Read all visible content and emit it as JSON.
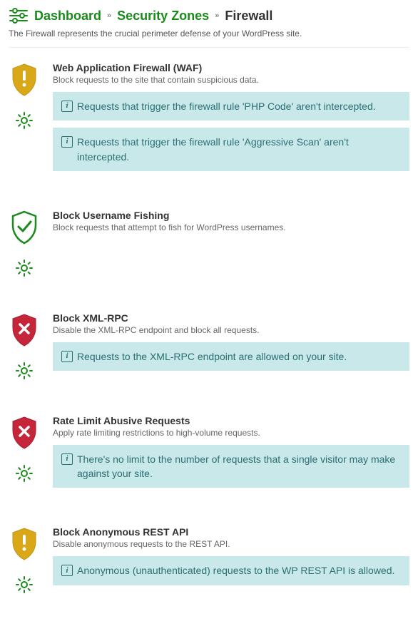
{
  "breadcrumb": {
    "dashboard": "Dashboard",
    "zones": "Security Zones",
    "current": "Firewall"
  },
  "subtitle": "The Firewall represents the crucial perimeter defense of your WordPress site.",
  "modules": [
    {
      "title": "Web Application Firewall (WAF)",
      "desc": "Block requests to the site that contain suspicious data.",
      "status": "warn",
      "notices": [
        "Requests that trigger the firewall rule 'PHP Code' aren't intercepted.",
        "Requests that trigger the firewall rule 'Aggressive Scan' aren't intercepted."
      ]
    },
    {
      "title": "Block Username Fishing",
      "desc": "Block requests that attempt to fish for WordPress usernames.",
      "status": "ok",
      "notices": []
    },
    {
      "title": "Block XML-RPC",
      "desc": "Disable the XML-RPC endpoint and block all requests.",
      "status": "off",
      "notices": [
        "Requests to the XML-RPC endpoint are allowed on your site."
      ]
    },
    {
      "title": "Rate Limit Abusive Requests",
      "desc": "Apply rate limiting restrictions to high-volume requests.",
      "status": "off",
      "notices": [
        "There's no limit to the number of requests that a single visitor may make against your site."
      ]
    },
    {
      "title": "Block Anonymous REST API",
      "desc": "Disable anonymous requests to the REST API.",
      "status": "warn",
      "notices": [
        "Anonymous (unauthenticated) requests to the WP REST API is allowed."
      ]
    }
  ]
}
